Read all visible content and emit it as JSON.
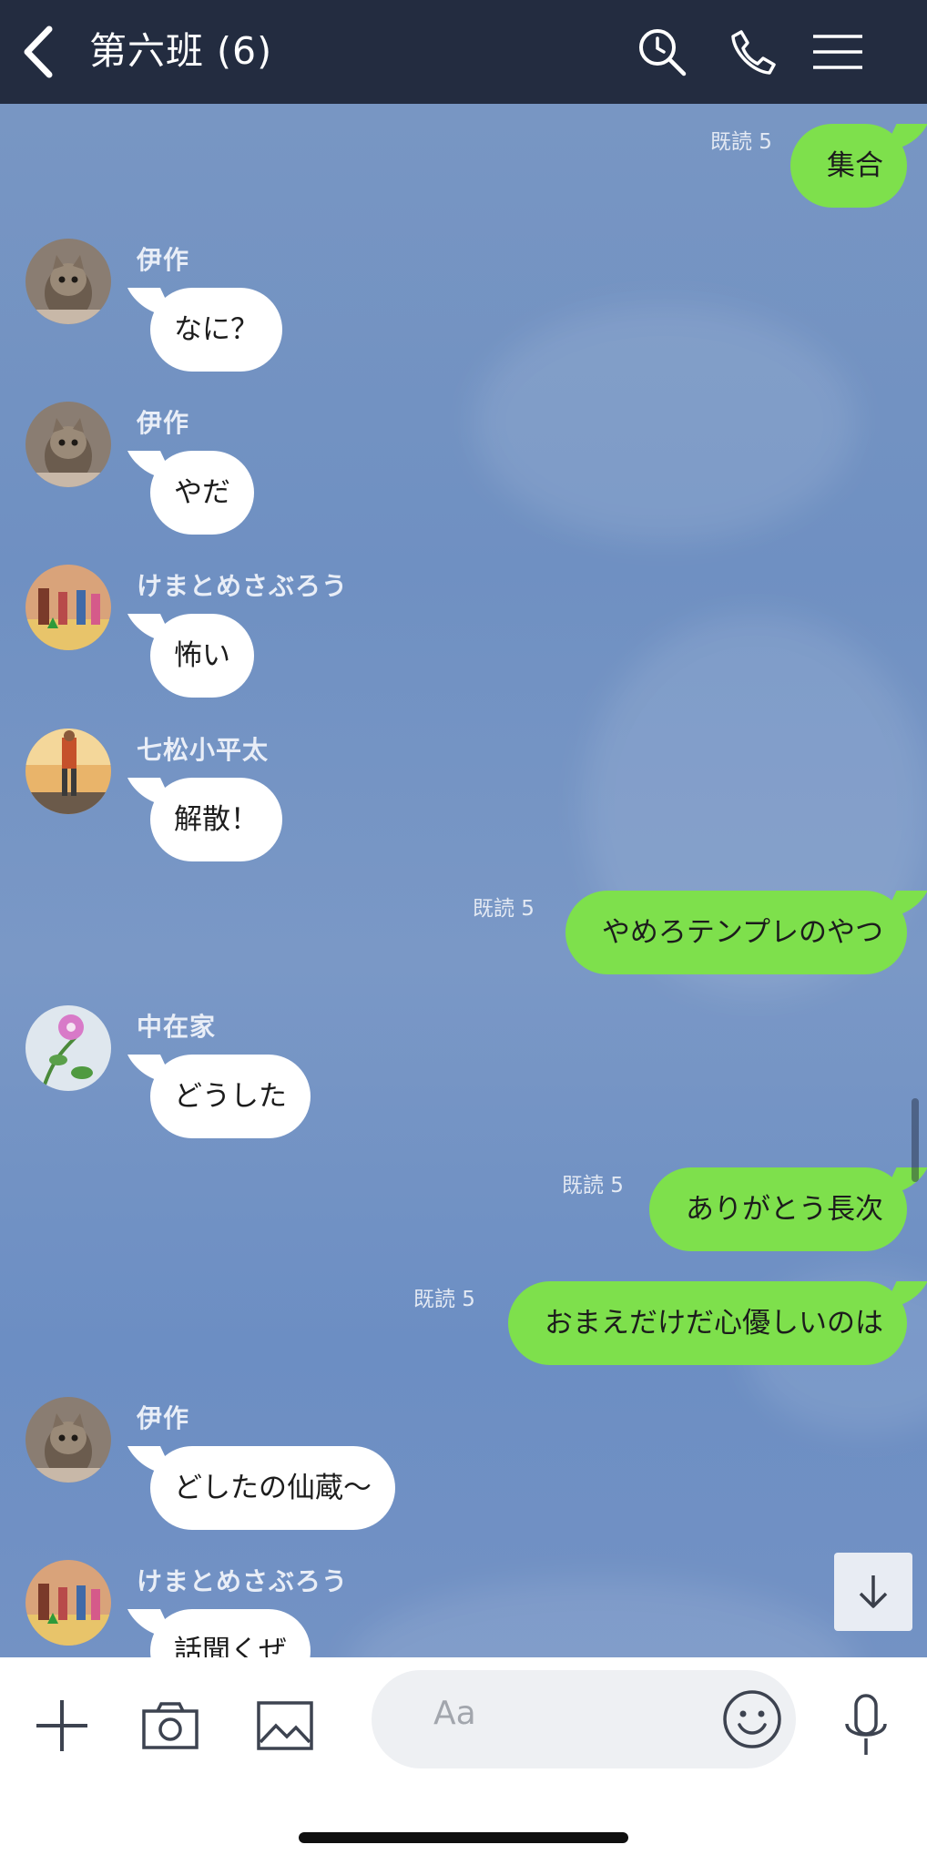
{
  "header": {
    "title": "第六班 (6)",
    "icons": [
      "back-icon",
      "search-icon",
      "phone-icon",
      "menu-icon"
    ]
  },
  "messages": [
    {
      "type": "out",
      "text": "集合",
      "read": "既読 5"
    },
    {
      "type": "in",
      "sender": "伊作",
      "text": "なに？"
    },
    {
      "type": "in",
      "sender": "伊作",
      "text": "やだ"
    },
    {
      "type": "in",
      "sender": "けまとめさぶろう",
      "text": "怖い"
    },
    {
      "type": "in",
      "sender": "七松小平太",
      "text": "解散！"
    },
    {
      "type": "out",
      "text": "やめろテンプレのやつ",
      "read": "既読 5"
    },
    {
      "type": "in",
      "sender": "中在家",
      "text": "どうした"
    },
    {
      "type": "out",
      "text": "ありがとう長次",
      "read": "既読 5"
    },
    {
      "type": "out",
      "text": "おまえだけだ心優しいのは",
      "read": "既読 5"
    },
    {
      "type": "in",
      "sender": "伊作",
      "text": "どしたの仙蔵〜"
    },
    {
      "type": "in",
      "sender": "けまとめさぶろう",
      "text": "話聞くぜ"
    }
  ],
  "footer": {
    "input_placeholder": "Aa",
    "icons": [
      "plus-icon",
      "camera-icon",
      "image-icon",
      "emoji-icon",
      "microphone-icon"
    ]
  },
  "colors": {
    "header_bg": "#232c40",
    "chat_bg": "#7392c4",
    "out_bubble": "#7ee04c",
    "in_bubble": "#ffffff"
  }
}
